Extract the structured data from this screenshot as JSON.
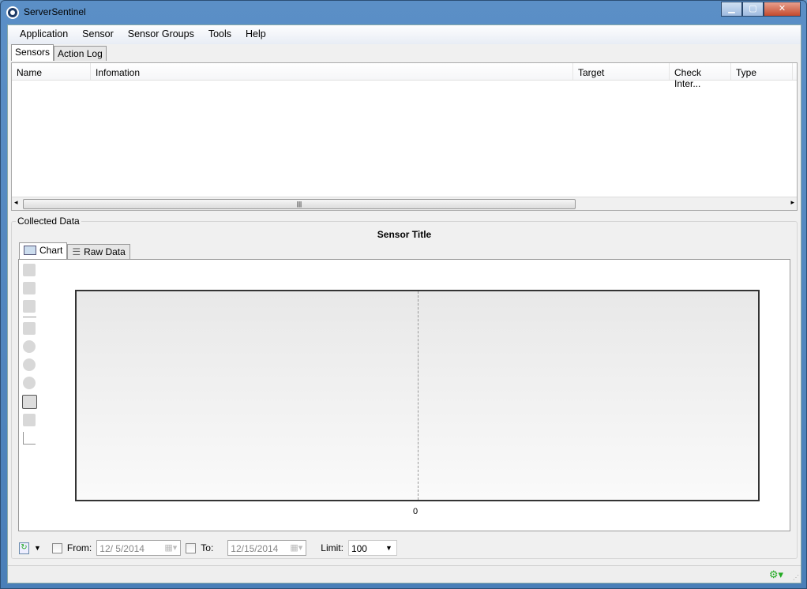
{
  "window": {
    "title": "ServerSentinel"
  },
  "menu": [
    "Application",
    "Sensor",
    "Sensor Groups",
    "Tools",
    "Help"
  ],
  "tabs": [
    "Sensors",
    "Action Log"
  ],
  "sensors_table": {
    "columns": [
      "Name",
      "Infomation",
      "Target",
      "Check Inter...",
      "Type"
    ],
    "rows": []
  },
  "collected": {
    "label": "Collected Data",
    "title": "Sensor Title",
    "tabs": [
      "Chart",
      "Raw Data"
    ]
  },
  "chart_data": {
    "type": "line",
    "title": "Sensor Title",
    "x_ticks": [
      "0"
    ],
    "series": [],
    "grid": false
  },
  "toolbar": {
    "from_label": "From:",
    "from_value": "12/ 5/2014",
    "to_label": "To:",
    "to_value": "12/15/2014",
    "limit_label": "Limit:",
    "limit_value": "100"
  }
}
